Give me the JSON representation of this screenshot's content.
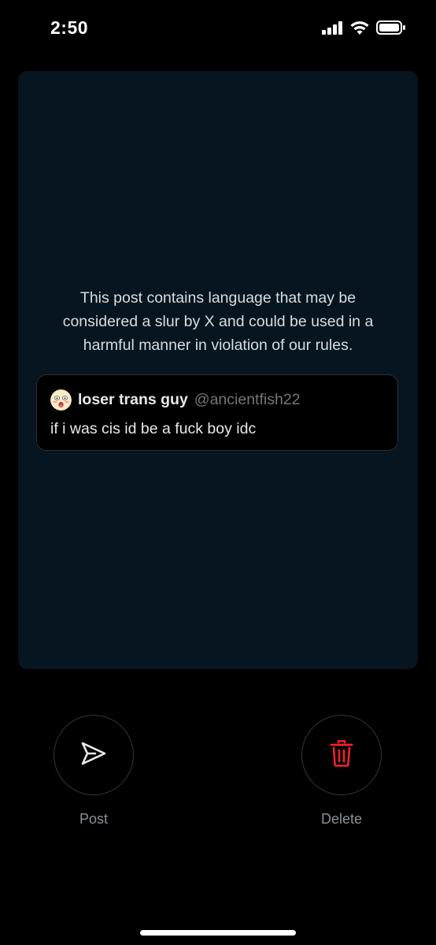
{
  "status_bar": {
    "time": "2:50",
    "icons": [
      "cellular-signal-icon",
      "wifi-icon",
      "battery-icon"
    ]
  },
  "card": {
    "warning_text": "This post contains language that may be considered a slur by X and could be used in a harmful manner in violation of our rules.",
    "quoted_post": {
      "display_name": "loser trans guy",
      "handle": "@ancientfish22",
      "text": "if i was cis id be a fuck boy idc"
    }
  },
  "actions": {
    "post": {
      "label": "Post",
      "icon": "send-icon"
    },
    "delete": {
      "label": "Delete",
      "icon": "trash-icon",
      "color": "#f4212e"
    }
  },
  "colors": {
    "background": "#000000",
    "card_background": "#061520",
    "delete_red": "#f4212e",
    "muted_text": "#71767b"
  }
}
